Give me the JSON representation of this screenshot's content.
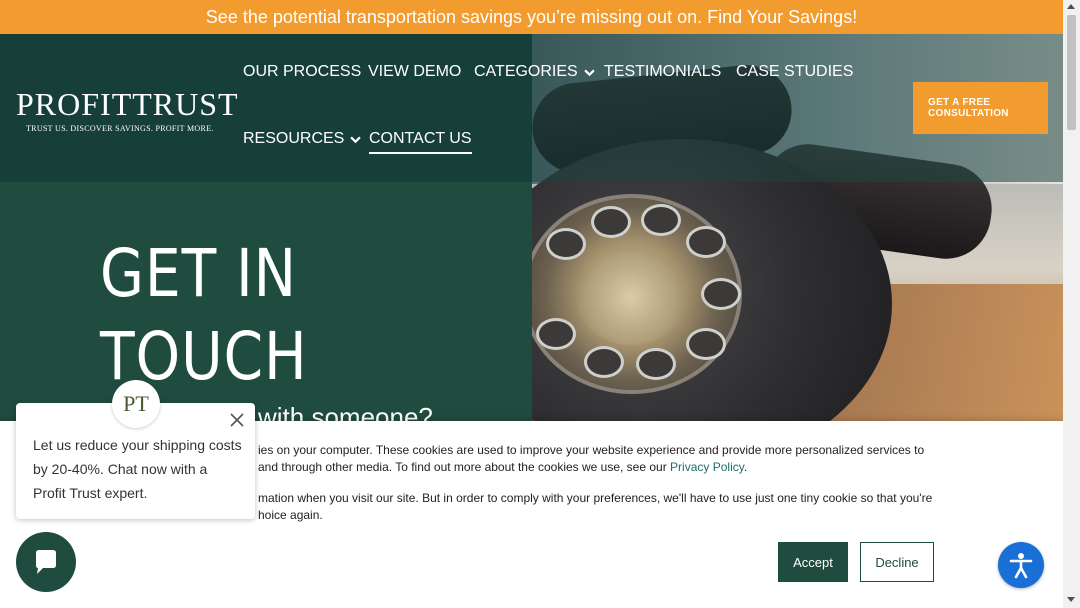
{
  "promo": {
    "text": "See the potential transportation savings you’re missing out on. Find Your Savings!"
  },
  "logo": {
    "wordmark": "PROFITTRUST",
    "tagline": "TRUST US. DISCOVER SAVINGS. PROFIT MORE."
  },
  "nav": {
    "items": [
      {
        "label": "OUR PROCESS",
        "dropdown": false
      },
      {
        "label": "VIEW DEMO",
        "dropdown": false
      },
      {
        "label": "CATEGORIES",
        "dropdown": true
      },
      {
        "label": "TESTIMONIALS",
        "dropdown": false
      },
      {
        "label": "CASE STUDIES",
        "dropdown": false
      },
      {
        "label": "RESOURCES",
        "dropdown": true
      },
      {
        "label": "CONTACT US",
        "dropdown": false,
        "active": true
      }
    ]
  },
  "cta": {
    "line1": "GET A FREE",
    "line2": "CONSULTATION"
  },
  "hero": {
    "title_line1": "GET IN",
    "title_line2": "TOUCH",
    "subtitle": "with someone?"
  },
  "cookie": {
    "para1_text": "ies on your computer. These cookies are used to improve your website experience and provide more personalized services to",
    "para1_text2": " and through other media. To find out more about the cookies we use, see our ",
    "privacy_link": "Privacy Policy",
    "para1_end": ".",
    "para2_text": "mation when you visit our site. But in order to comply with your preferences, we'll have to use just one tiny cookie so that you're",
    "para2_text2": "hoice again.",
    "accept_label": "Accept",
    "decline_label": "Decline"
  },
  "chat": {
    "message": "Let us reduce your shipping costs by 20-40%. Chat now with a Profit Trust expert.",
    "avatar_initials": "PT"
  },
  "colors": {
    "brand_dark": "#173f3a",
    "brand_green": "#1f4c3f",
    "accent_orange": "#f29b2e",
    "a11y_blue": "#1a6fd6"
  }
}
